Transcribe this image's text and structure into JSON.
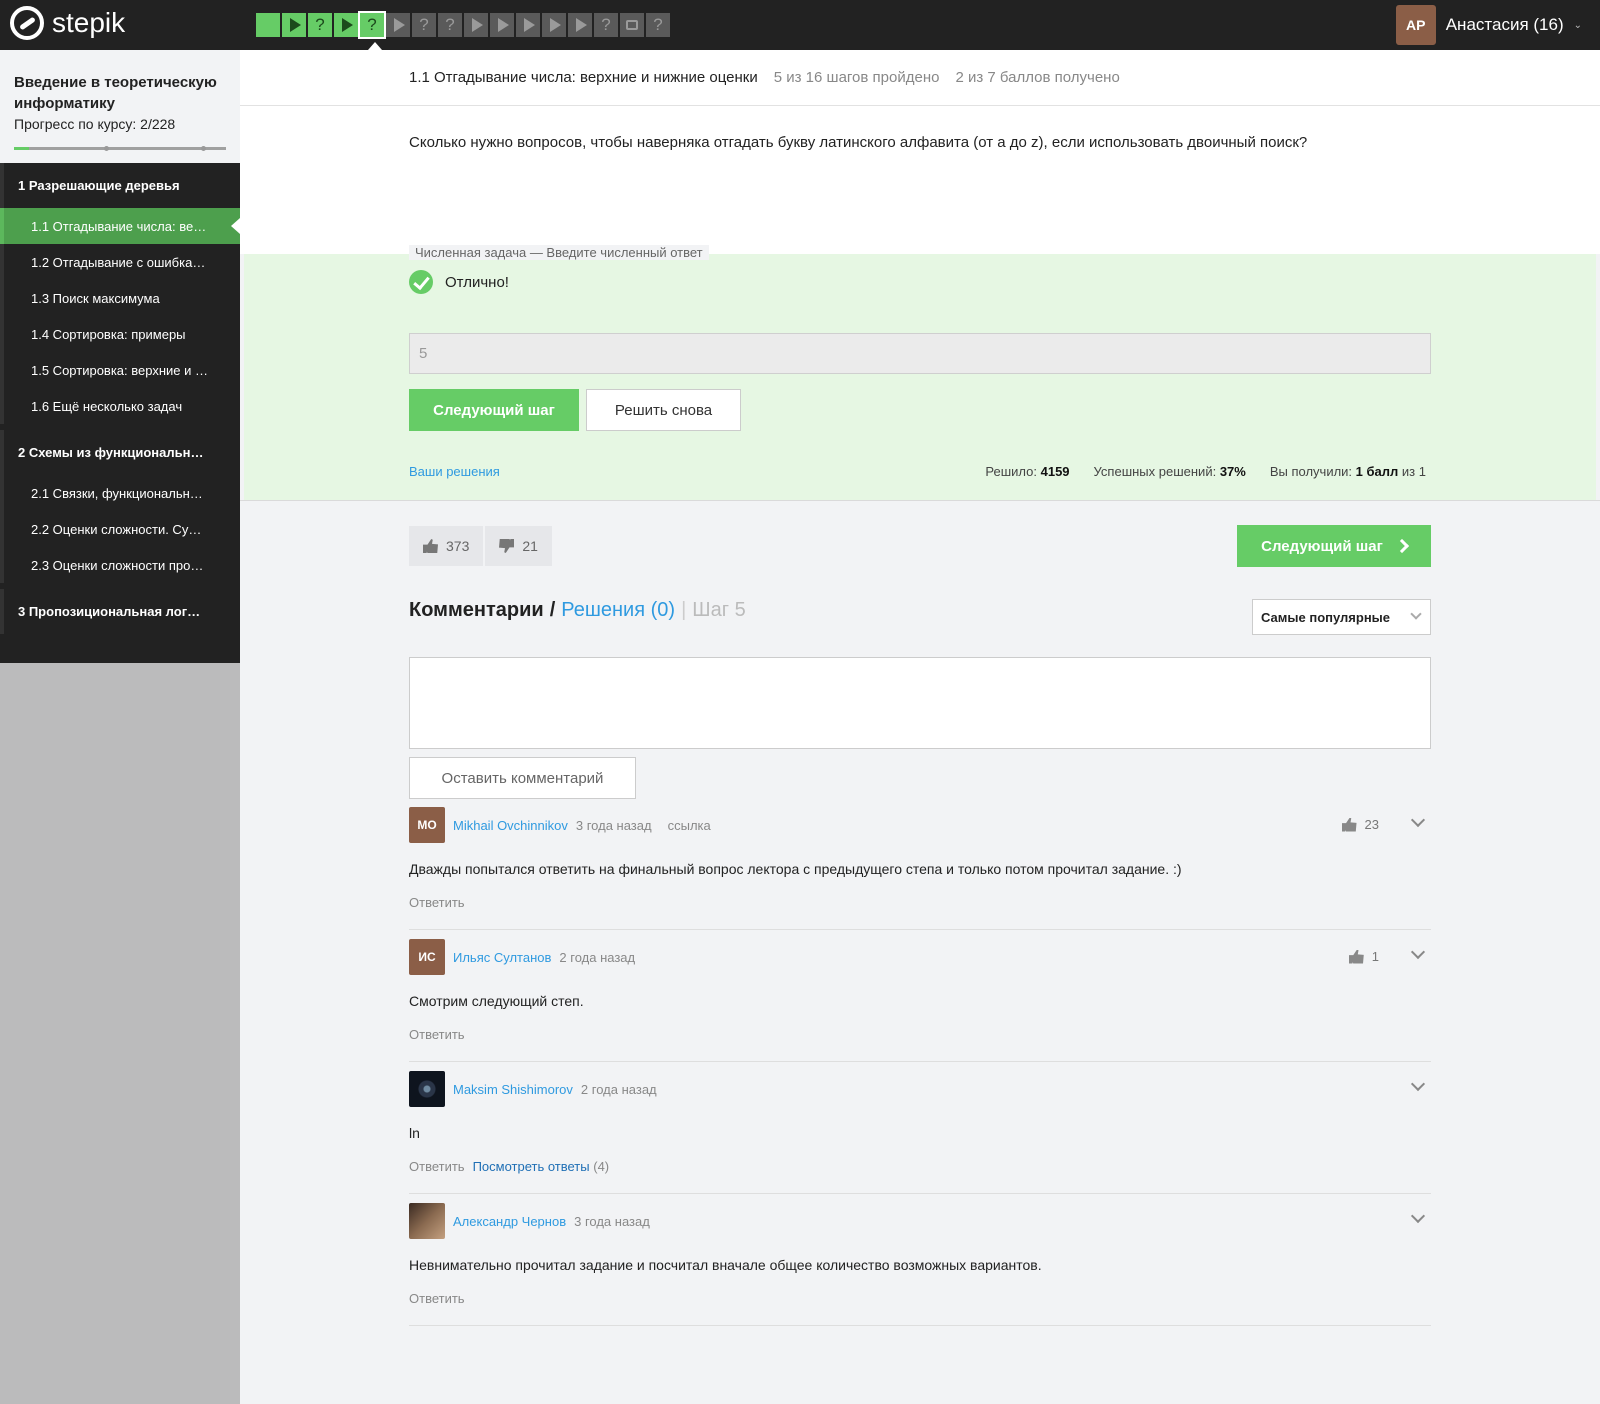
{
  "app": {
    "logo_text": "stepik"
  },
  "nav": {
    "steps": [
      {
        "type": "text",
        "state": "done"
      },
      {
        "type": "video",
        "state": "done"
      },
      {
        "type": "quiz",
        "state": "done"
      },
      {
        "type": "video",
        "state": "done"
      },
      {
        "type": "quiz",
        "state": "active"
      },
      {
        "type": "video",
        "state": "todo"
      },
      {
        "type": "quiz",
        "state": "todo"
      },
      {
        "type": "quiz",
        "state": "todo"
      },
      {
        "type": "video",
        "state": "todo"
      },
      {
        "type": "video",
        "state": "todo"
      },
      {
        "type": "video",
        "state": "todo"
      },
      {
        "type": "video",
        "state": "todo"
      },
      {
        "type": "video",
        "state": "todo"
      },
      {
        "type": "quiz",
        "state": "todo"
      },
      {
        "type": "discussion",
        "state": "todo"
      },
      {
        "type": "quiz",
        "state": "todo"
      }
    ],
    "quiz_glyph": "?"
  },
  "user": {
    "initials": "АР",
    "name": "Анастасия (16)",
    "caret": "⌄"
  },
  "sidebar": {
    "course_title": "Введение в теоретическую информатику",
    "progress_label": "Прогресс по курсу:",
    "progress_value": "2/228",
    "progress_fraction": 0.0088,
    "sections": [
      {
        "title": "1  Разрешающие деревья",
        "lessons": [
          {
            "label": "1.1  Отгадывание числа: ве…",
            "current": true
          },
          {
            "label": "1.2  Отгадывание с ошибка…",
            "current": false
          },
          {
            "label": "1.3  Поиск максимума",
            "current": false
          },
          {
            "label": "1.4  Сортировка: примеры",
            "current": false
          },
          {
            "label": "1.5  Сортировка: верхние и …",
            "current": false
          },
          {
            "label": "1.6  Ещё несколько задач",
            "current": false
          }
        ]
      },
      {
        "title": "2  Схемы из функциональн…",
        "lessons": [
          {
            "label": "2.1  Связки, функциональн…",
            "current": false
          },
          {
            "label": "2.2  Оценки сложности. Су…",
            "current": false
          },
          {
            "label": "2.3  Оценки сложности про…",
            "current": false
          }
        ]
      },
      {
        "title": "3  Пропозициональная лог…",
        "lessons": []
      }
    ]
  },
  "lesson": {
    "title": "1.1 Отгадывание числа: верхние и нижние оценки",
    "steps_passed": "5 из 16 шагов пройдено",
    "points": "2 из 7 баллов  получено"
  },
  "question": "Сколько нужно вопросов, чтобы наверняка отгадать букву латинского алфавита (от a до z), если использовать двоичный поиск?",
  "quiz": {
    "legend": "Численная задача — Введите численный ответ",
    "result": "Отлично!",
    "answer": "5",
    "next_label": "Следующий шаг",
    "retry_label": "Решить снова",
    "your_solutions": "Ваши решения",
    "solved_label": "Решило:",
    "solved_value": "4159",
    "success_label": "Успешных решений:",
    "success_value": "37%",
    "got_label": "Вы получили:",
    "got_value": "1 балл",
    "got_of": "из 1"
  },
  "votes": {
    "likes": "373",
    "dislikes": "21"
  },
  "next_step_label": "Следующий шаг",
  "comments": {
    "title": "Комментарии",
    "slash": "/",
    "solutions": "Решения (0)",
    "sep": "|",
    "step": "Шаг 5",
    "sort": "Самые популярные",
    "submit": "Оставить комментарий",
    "reply": "Ответить",
    "view_replies": "Посмотреть ответы",
    "items": [
      {
        "initials": "МО",
        "avatar": "brown",
        "author": "Mikhail Ovchinnikov",
        "time": "3 года назад",
        "link": "ссылка",
        "likes": "23",
        "text": "Дважды попытался ответить на финальный вопрос лектора с предыдущего степа и только потом прочитал задание. :)"
      },
      {
        "initials": "ИС",
        "avatar": "brown",
        "author": "Ильяс Султанов",
        "time": "2 года назад",
        "link": "",
        "likes": "1",
        "text": "Смотрим следующий степ."
      },
      {
        "initials": "",
        "avatar": "dark",
        "author": "Maksim Shishimorov",
        "time": "2 года назад",
        "link": "",
        "likes": "",
        "text": "ln",
        "replies": "(4)"
      },
      {
        "initials": "",
        "avatar": "photo",
        "author": "Александр Чернов",
        "time": "3 года назад",
        "link": "",
        "likes": "",
        "text": "Невнимательно прочитал задание и посчитал вначале общее количество возможных вариантов."
      }
    ]
  },
  "colors": {
    "accent_green": "#66cc66",
    "link_blue": "#2f9ae0",
    "topbar": "#222222"
  }
}
